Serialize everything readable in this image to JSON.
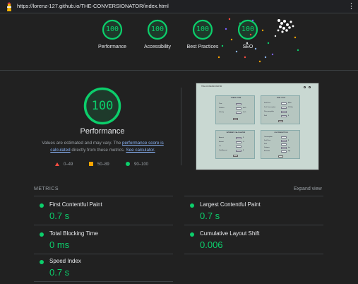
{
  "browser": {
    "url": "https://lorenz-127.github.io/THE-CONVERSIONATOR/index.html",
    "menu_icon": "vertical-ellipsis-icon",
    "logo_icon": "lighthouse-icon"
  },
  "summary": {
    "gauges": [
      {
        "score": "100",
        "label": "Performance"
      },
      {
        "score": "100",
        "label": "Accessibility"
      },
      {
        "score": "100",
        "label": "Best Practices"
      },
      {
        "score": "100",
        "label": "SEO"
      }
    ]
  },
  "performance": {
    "score": "100",
    "title": "Performance",
    "note_prefix": "Values are estimated and may vary. The ",
    "note_link1": "performance score is calculated",
    "note_middle": " directly from these metrics. ",
    "note_link2": "See calculator."
  },
  "legend": {
    "fail": "0–49",
    "average": "50–89",
    "pass": "90–100"
  },
  "screenshot": {
    "title": "THE-CONVERSIONATOR",
    "panels": [
      {
        "title": "TRAVEL TIME",
        "rows": [
          [
            "Time",
            "",
            ""
          ],
          [
            "Distance",
            "",
            "km/h"
          ],
          [
            "Velocity",
            "",
            "km/h"
          ]
        ]
      },
      {
        "title": "FUEL COST",
        "rows": [
          [
            "Fuel Price",
            "",
            "$/liter"
          ],
          [
            "Fuel Consumption",
            "",
            "l/100km"
          ],
          [
            "Price per gallon",
            "",
            ""
          ],
          [
            "Fuel",
            "",
            "$"
          ]
        ]
      },
      {
        "title": "INTEREST CALCULATOR",
        "rows": [
          [
            "Amount",
            "",
            "$"
          ],
          [
            "Interest",
            "",
            "%"
          ],
          [
            "Yrs",
            "",
            ""
          ],
          [
            "Total Amount",
            "",
            "$"
          ]
        ]
      },
      {
        "title": "OIL PRODUCTION",
        "rows": [
          [
            "Consumption",
            "",
            ""
          ],
          [
            "Fuel Price",
            "",
            "$"
          ],
          [
            "Fuel",
            "",
            ""
          ],
          [
            "Distance",
            "",
            "km"
          ],
          [
            "Emission",
            "",
            "kg/l"
          ]
        ]
      }
    ]
  },
  "metrics": {
    "heading": "METRICS",
    "expand_label": "Expand view",
    "items": [
      {
        "name": "First Contentful Paint",
        "value": "0.7 s"
      },
      {
        "name": "Largest Contentful Paint",
        "value": "0.7 s"
      },
      {
        "name": "Total Blocking Time",
        "value": "0 ms"
      },
      {
        "name": "Cumulative Layout Shift",
        "value": "0.006"
      },
      {
        "name": "Speed Index",
        "value": "0.7 s"
      }
    ]
  },
  "colors": {
    "pass": "#0cce6b",
    "average": "#ffa400",
    "fail": "#ff4e42",
    "background": "#212121",
    "link": "#8ab4f8"
  }
}
